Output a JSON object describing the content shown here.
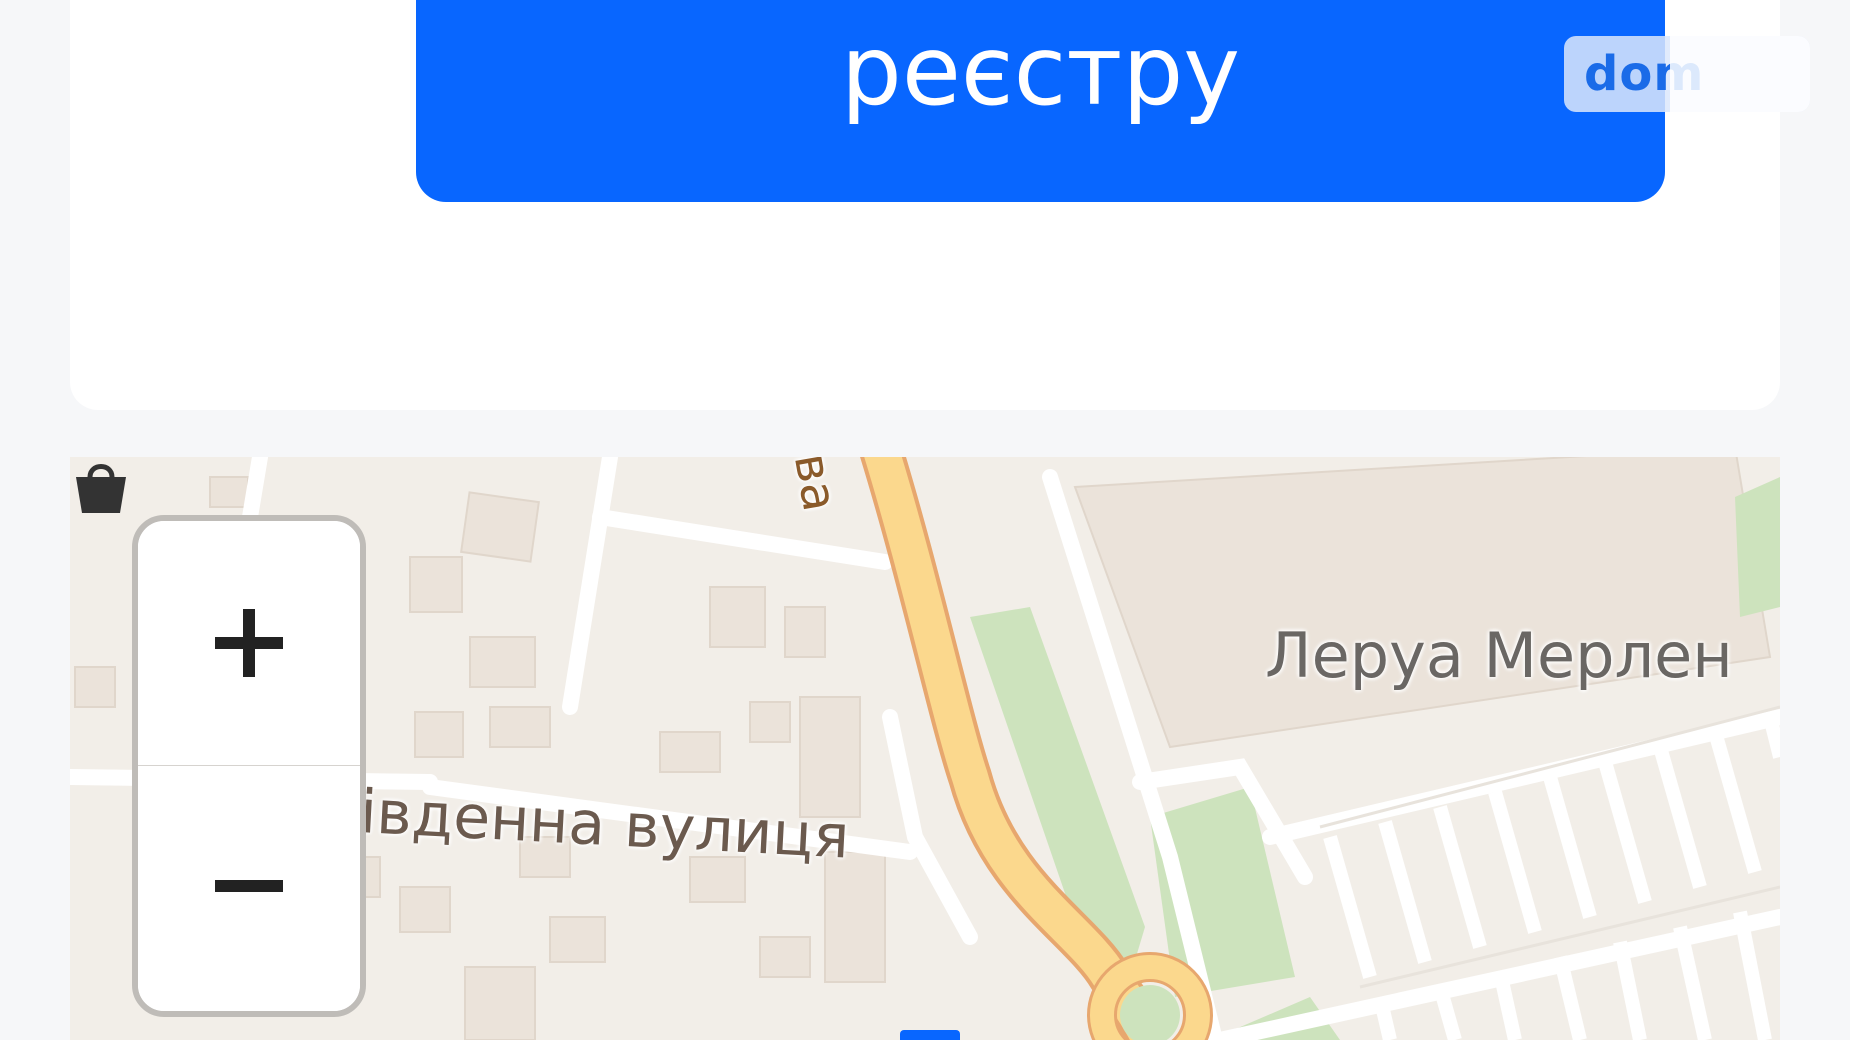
{
  "registry_button": {
    "label": "реєстру"
  },
  "badge": {
    "text": "dom",
    "accent": "#1a6be8"
  },
  "map": {
    "labels": {
      "street": "івденна вулиця",
      "store": "Леруа Мерлен",
      "road_fragment": "ва"
    },
    "zoom": {
      "in": "+",
      "out": "−"
    },
    "icons": [
      "shopping-bag-icon",
      "plus-icon",
      "minus-icon"
    ]
  },
  "colors": {
    "primary_button": "#0866ff",
    "page_background": "#f6f7f9",
    "map_background": "#f2eee8",
    "main_road": "#fbd88d",
    "green_area": "#cde3bd"
  }
}
